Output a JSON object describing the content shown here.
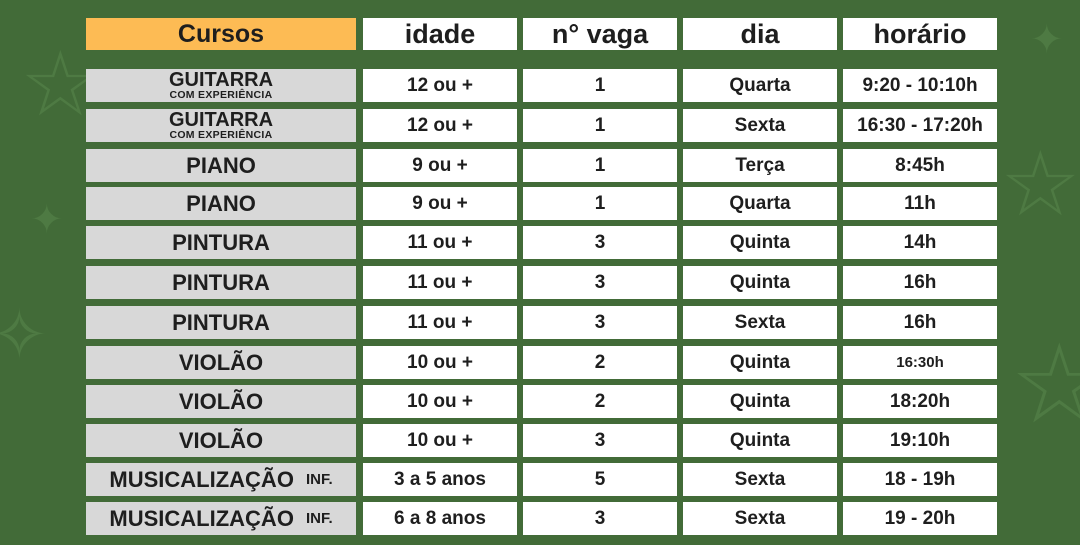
{
  "header": {
    "cursos": "Cursos",
    "idade": "idade",
    "vaga": "n° vaga",
    "dia": "dia",
    "horario": "horário"
  },
  "rows": [
    {
      "curso": "GUITARRA",
      "sub": "COM EXPERIÊNCIA",
      "idade": "12 ou +",
      "vaga": "1",
      "dia": "Quarta",
      "horario": "9:20 - 10:10h"
    },
    {
      "curso": "GUITARRA",
      "sub": "COM EXPERIÊNCIA",
      "idade": "12 ou +",
      "vaga": "1",
      "dia": "Sexta",
      "horario": "16:30 - 17:20h"
    },
    {
      "curso": "PIANO",
      "idade": "9 ou +",
      "vaga": "1",
      "dia": "Terça",
      "horario": "8:45h"
    },
    {
      "curso": "PIANO",
      "idade": "9 ou +",
      "vaga": "1",
      "dia": "Quarta",
      "horario": "11h"
    },
    {
      "curso": "PINTURA",
      "idade": "11 ou +",
      "vaga": "3",
      "dia": "Quinta",
      "horario": "14h"
    },
    {
      "curso": "PINTURA",
      "idade": "11 ou +",
      "vaga": "3",
      "dia": "Quinta",
      "horario": "16h"
    },
    {
      "curso": "PINTURA",
      "idade": "11 ou +",
      "vaga": "3",
      "dia": "Sexta",
      "horario": "16h"
    },
    {
      "curso": "VIOLÃO",
      "idade": "10 ou +",
      "vaga": "2",
      "dia": "Quinta",
      "horario": "16:30h"
    },
    {
      "curso": "VIOLÃO",
      "idade": "10 ou +",
      "vaga": "2",
      "dia": "Quinta",
      "horario": "18:20h"
    },
    {
      "curso": "VIOLÃO",
      "idade": "10 ou +",
      "vaga": "3",
      "dia": "Quinta",
      "horario": "19:10h"
    },
    {
      "curso": "MUSICALIZAÇÃO",
      "inf": "INF.",
      "idade": "3 a 5 anos",
      "vaga": "5",
      "dia": "Sexta",
      "horario": "18 - 19h"
    },
    {
      "curso": "MUSICALIZAÇÃO",
      "inf": "INF.",
      "idade": "6 a 8 anos",
      "vaga": "3",
      "dia": "Sexta",
      "horario": "19 - 20h"
    }
  ],
  "colors": {
    "background": "#426b38",
    "header_accent": "#fdbb54",
    "course_cell": "#d8d8d8",
    "value_cell": "#ffffff",
    "text": "#1e1e1e"
  },
  "decorations": [
    "star-icon",
    "star-icon",
    "star-icon",
    "star-icon",
    "star-icon",
    "star-icon"
  ]
}
